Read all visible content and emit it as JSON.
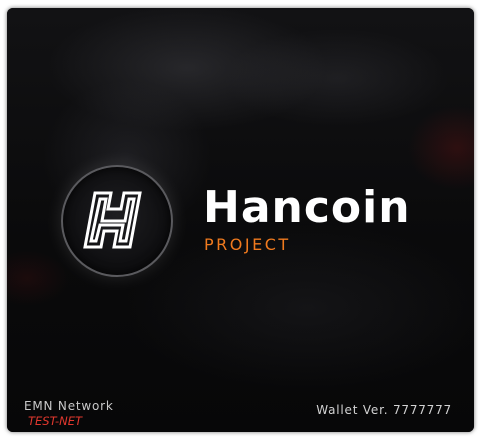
{
  "splash": {
    "logo_icon": "hancoin-h-logo-icon",
    "title": "Hancoin",
    "subtitle": "PROJECT",
    "network": {
      "name": "EMN Network",
      "mode": "TEST-NET"
    },
    "wallet_version": "Wallet Ver. 7777777"
  },
  "colors": {
    "background": "#0c0c0e",
    "title": "#ffffff",
    "subtitle_accent": "#f07a1e",
    "testnet_badge": "#e2382e",
    "footer_text": "#c9c9c9"
  }
}
